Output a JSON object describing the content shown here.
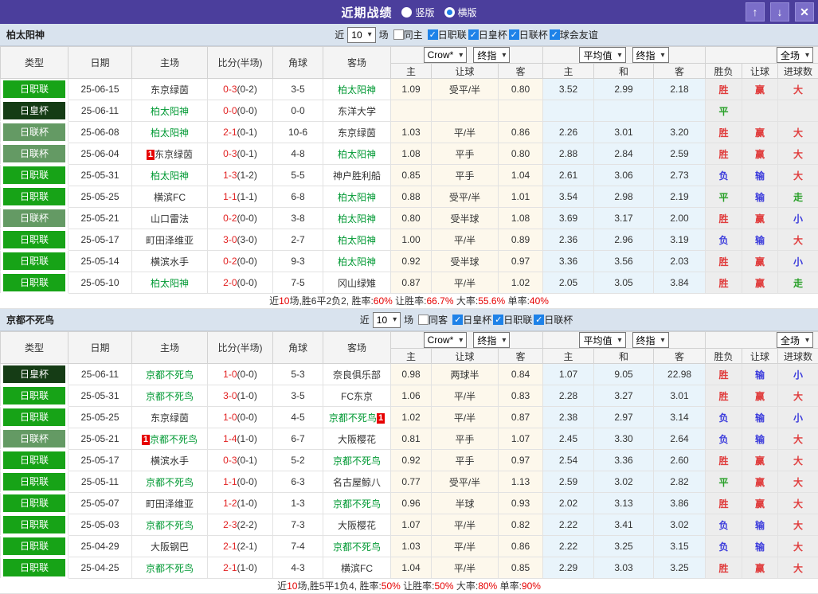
{
  "titlebar": {
    "title": "近期战绩",
    "radio_vertical": "竖版",
    "radio_horizontal": "横版",
    "selected_mode": "横版"
  },
  "icons": {
    "up": "↑",
    "down": "↓",
    "close": "✕",
    "check": "✓",
    "select_arrow": "▾"
  },
  "colors": {
    "titlebar_bg": "#4b3e9c",
    "button_bg": "#7b6ec9",
    "filter_bg": "#d9e3ee",
    "checkbox_blue": "#1e82e8",
    "score_red": "#e22020",
    "focus_green": "#009933",
    "summary_red": "#e60000",
    "asia_col_bg": "#fdf8ec",
    "avg_col_bg": "#e9f4fb",
    "result_col_bg": "#ededed",
    "league": {
      "日职联": "#17a317",
      "日皇杯": "#153c15",
      "日联杯": "#649a64"
    },
    "result": {
      "胜": "#e03c3c",
      "负": "#3c3cdc",
      "平": "#28a028",
      "赢": "#e03c3c",
      "输": "#3c3cdc",
      "走": "#28a028",
      "大": "#e03c3c",
      "小": "#3c3cdc"
    }
  },
  "table_head": {
    "type": "类型",
    "date": "日期",
    "home": "主场",
    "score": "比分(半场)",
    "corners": "角球",
    "away": "客场",
    "asia_sub": [
      "主",
      "让球",
      "客"
    ],
    "euro_sub": [
      "主",
      "和",
      "客"
    ],
    "result_sub": [
      "胜负",
      "让球",
      "进球数"
    ],
    "selects": {
      "bookmaker": "Crow*",
      "final1": "终指",
      "average": "平均值",
      "final2": "终指",
      "scope": "全场"
    }
  },
  "sections": [
    {
      "team": "柏太阳神",
      "filter": {
        "prefix": "近",
        "count": "10",
        "suffix": "场",
        "same": "同主",
        "same_checked": false,
        "leagues": [
          "日职联",
          "日皇杯",
          "日联杯",
          "球会友谊"
        ]
      },
      "rows": [
        {
          "league": "日职联",
          "date": "25-06-15",
          "home": "东京绿茵",
          "home_focus": false,
          "home_card": "",
          "score": "0-3",
          "half": "(0-2)",
          "corners": "3-5",
          "away": "柏太阳神",
          "away_focus": true,
          "away_card": "",
          "odds": [
            "1.09",
            "受平/半",
            "0.80"
          ],
          "avg": [
            "3.52",
            "2.99",
            "2.18"
          ],
          "result": [
            "胜",
            "赢",
            "大"
          ]
        },
        {
          "league": "日皇杯",
          "date": "25-06-11",
          "home": "柏太阳神",
          "home_focus": true,
          "home_card": "",
          "score": "0-0",
          "half": "(0-0)",
          "corners": "0-0",
          "away": "东洋大学",
          "away_focus": false,
          "away_card": "",
          "odds": [
            "",
            "",
            ""
          ],
          "avg": [
            "",
            "",
            ""
          ],
          "result": [
            "平",
            "",
            ""
          ]
        },
        {
          "league": "日联杯",
          "date": "25-06-08",
          "home": "柏太阳神",
          "home_focus": true,
          "home_card": "",
          "score": "2-1",
          "half": "(0-1)",
          "corners": "10-6",
          "away": "东京绿茵",
          "away_focus": false,
          "away_card": "",
          "odds": [
            "1.03",
            "平/半",
            "0.86"
          ],
          "avg": [
            "2.26",
            "3.01",
            "3.20"
          ],
          "result": [
            "胜",
            "赢",
            "大"
          ]
        },
        {
          "league": "日联杯",
          "date": "25-06-04",
          "home": "东京绿茵",
          "home_focus": false,
          "home_card": "1",
          "score": "0-3",
          "half": "(0-1)",
          "corners": "4-8",
          "away": "柏太阳神",
          "away_focus": true,
          "away_card": "",
          "odds": [
            "1.08",
            "平手",
            "0.80"
          ],
          "avg": [
            "2.88",
            "2.84",
            "2.59"
          ],
          "result": [
            "胜",
            "赢",
            "大"
          ]
        },
        {
          "league": "日职联",
          "date": "25-05-31",
          "home": "柏太阳神",
          "home_focus": true,
          "home_card": "",
          "score": "1-3",
          "half": "(1-2)",
          "corners": "5-5",
          "away": "神户胜利船",
          "away_focus": false,
          "away_card": "",
          "odds": [
            "0.85",
            "平手",
            "1.04"
          ],
          "avg": [
            "2.61",
            "3.06",
            "2.73"
          ],
          "result": [
            "负",
            "输",
            "大"
          ]
        },
        {
          "league": "日职联",
          "date": "25-05-25",
          "home": "横滨FC",
          "home_focus": false,
          "home_card": "",
          "score": "1-1",
          "half": "(1-1)",
          "corners": "6-8",
          "away": "柏太阳神",
          "away_focus": true,
          "away_card": "",
          "odds": [
            "0.88",
            "受平/半",
            "1.01"
          ],
          "avg": [
            "3.54",
            "2.98",
            "2.19"
          ],
          "result": [
            "平",
            "输",
            "走"
          ]
        },
        {
          "league": "日联杯",
          "date": "25-05-21",
          "home": "山口雷法",
          "home_focus": false,
          "home_card": "",
          "score": "0-2",
          "half": "(0-0)",
          "corners": "3-8",
          "away": "柏太阳神",
          "away_focus": true,
          "away_card": "",
          "odds": [
            "0.80",
            "受半球",
            "1.08"
          ],
          "avg": [
            "3.69",
            "3.17",
            "2.00"
          ],
          "result": [
            "胜",
            "赢",
            "小"
          ]
        },
        {
          "league": "日职联",
          "date": "25-05-17",
          "home": "町田泽维亚",
          "home_focus": false,
          "home_card": "",
          "score": "3-0",
          "half": "(3-0)",
          "corners": "2-7",
          "away": "柏太阳神",
          "away_focus": true,
          "away_card": "",
          "odds": [
            "1.00",
            "平/半",
            "0.89"
          ],
          "avg": [
            "2.36",
            "2.96",
            "3.19"
          ],
          "result": [
            "负",
            "输",
            "大"
          ]
        },
        {
          "league": "日职联",
          "date": "25-05-14",
          "home": "横滨水手",
          "home_focus": false,
          "home_card": "",
          "score": "0-2",
          "half": "(0-0)",
          "corners": "9-3",
          "away": "柏太阳神",
          "away_focus": true,
          "away_card": "",
          "odds": [
            "0.92",
            "受半球",
            "0.97"
          ],
          "avg": [
            "3.36",
            "3.56",
            "2.03"
          ],
          "result": [
            "胜",
            "赢",
            "小"
          ]
        },
        {
          "league": "日职联",
          "date": "25-05-10",
          "home": "柏太阳神",
          "home_focus": true,
          "home_card": "",
          "score": "2-0",
          "half": "(0-0)",
          "corners": "7-5",
          "away": "冈山绿雉",
          "away_focus": false,
          "away_card": "",
          "odds": [
            "0.87",
            "平/半",
            "1.02"
          ],
          "avg": [
            "2.05",
            "3.05",
            "3.84"
          ],
          "result": [
            "胜",
            "赢",
            "走"
          ]
        }
      ],
      "summary": [
        {
          "text": "近",
          "red": false
        },
        {
          "text": "10",
          "red": true
        },
        {
          "text": "场,胜6平2负2, 胜率:",
          "red": false
        },
        {
          "text": "60%",
          "red": true
        },
        {
          "text": " 让胜率:",
          "red": false
        },
        {
          "text": "66.7%",
          "red": true
        },
        {
          "text": " 大率:",
          "red": false
        },
        {
          "text": "55.6%",
          "red": true
        },
        {
          "text": " 单率:",
          "red": false
        },
        {
          "text": "40%",
          "red": true
        }
      ]
    },
    {
      "team": "京都不死鸟",
      "filter": {
        "prefix": "近",
        "count": "10",
        "suffix": "场",
        "same": "同客",
        "same_checked": false,
        "leagues": [
          "日皇杯",
          "日职联",
          "日联杯"
        ]
      },
      "rows": [
        {
          "league": "日皇杯",
          "date": "25-06-11",
          "home": "京都不死鸟",
          "home_focus": true,
          "home_card": "",
          "score": "1-0",
          "half": "(0-0)",
          "corners": "5-3",
          "away": "奈良俱乐部",
          "away_focus": false,
          "away_card": "",
          "odds": [
            "0.98",
            "两球半",
            "0.84"
          ],
          "avg": [
            "1.07",
            "9.05",
            "22.98"
          ],
          "result": [
            "胜",
            "输",
            "小"
          ]
        },
        {
          "league": "日职联",
          "date": "25-05-31",
          "home": "京都不死鸟",
          "home_focus": true,
          "home_card": "",
          "score": "3-0",
          "half": "(1-0)",
          "corners": "3-5",
          "away": "FC东京",
          "away_focus": false,
          "away_card": "",
          "odds": [
            "1.06",
            "平/半",
            "0.83"
          ],
          "avg": [
            "2.28",
            "3.27",
            "3.01"
          ],
          "result": [
            "胜",
            "赢",
            "大"
          ]
        },
        {
          "league": "日职联",
          "date": "25-05-25",
          "home": "东京绿茵",
          "home_focus": false,
          "home_card": "",
          "score": "1-0",
          "half": "(0-0)",
          "corners": "4-5",
          "away": "京都不死鸟",
          "away_focus": true,
          "away_card": "1",
          "odds": [
            "1.02",
            "平/半",
            "0.87"
          ],
          "avg": [
            "2.38",
            "2.97",
            "3.14"
          ],
          "result": [
            "负",
            "输",
            "小"
          ]
        },
        {
          "league": "日联杯",
          "date": "25-05-21",
          "home": "京都不死鸟",
          "home_focus": true,
          "home_card": "1",
          "score": "1-4",
          "half": "(1-0)",
          "corners": "6-7",
          "away": "大阪樱花",
          "away_focus": false,
          "away_card": "",
          "odds": [
            "0.81",
            "平手",
            "1.07"
          ],
          "avg": [
            "2.45",
            "3.30",
            "2.64"
          ],
          "result": [
            "负",
            "输",
            "大"
          ]
        },
        {
          "league": "日职联",
          "date": "25-05-17",
          "home": "横滨水手",
          "home_focus": false,
          "home_card": "",
          "score": "0-3",
          "half": "(0-1)",
          "corners": "5-2",
          "away": "京都不死鸟",
          "away_focus": true,
          "away_card": "",
          "odds": [
            "0.92",
            "平手",
            "0.97"
          ],
          "avg": [
            "2.54",
            "3.36",
            "2.60"
          ],
          "result": [
            "胜",
            "赢",
            "大"
          ]
        },
        {
          "league": "日职联",
          "date": "25-05-11",
          "home": "京都不死鸟",
          "home_focus": true,
          "home_card": "",
          "score": "1-1",
          "half": "(0-0)",
          "corners": "6-3",
          "away": "名古屋鲸八",
          "away_focus": false,
          "away_card": "",
          "odds": [
            "0.77",
            "受平/半",
            "1.13"
          ],
          "avg": [
            "2.59",
            "3.02",
            "2.82"
          ],
          "result": [
            "平",
            "赢",
            "大"
          ]
        },
        {
          "league": "日职联",
          "date": "25-05-07",
          "home": "町田泽维亚",
          "home_focus": false,
          "home_card": "",
          "score": "1-2",
          "half": "(1-0)",
          "corners": "1-3",
          "away": "京都不死鸟",
          "away_focus": true,
          "away_card": "",
          "odds": [
            "0.96",
            "半球",
            "0.93"
          ],
          "avg": [
            "2.02",
            "3.13",
            "3.86"
          ],
          "result": [
            "胜",
            "赢",
            "大"
          ]
        },
        {
          "league": "日职联",
          "date": "25-05-03",
          "home": "京都不死鸟",
          "home_focus": true,
          "home_card": "",
          "score": "2-3",
          "half": "(2-2)",
          "corners": "7-3",
          "away": "大阪樱花",
          "away_focus": false,
          "away_card": "",
          "odds": [
            "1.07",
            "平/半",
            "0.82"
          ],
          "avg": [
            "2.22",
            "3.41",
            "3.02"
          ],
          "result": [
            "负",
            "输",
            "大"
          ]
        },
        {
          "league": "日职联",
          "date": "25-04-29",
          "home": "大阪钢巴",
          "home_focus": false,
          "home_card": "",
          "score": "2-1",
          "half": "(2-1)",
          "corners": "7-4",
          "away": "京都不死鸟",
          "away_focus": true,
          "away_card": "",
          "odds": [
            "1.03",
            "平/半",
            "0.86"
          ],
          "avg": [
            "2.22",
            "3.25",
            "3.15"
          ],
          "result": [
            "负",
            "输",
            "大"
          ]
        },
        {
          "league": "日职联",
          "date": "25-04-25",
          "home": "京都不死鸟",
          "home_focus": true,
          "home_card": "",
          "score": "2-1",
          "half": "(1-0)",
          "corners": "4-3",
          "away": "横滨FC",
          "away_focus": false,
          "away_card": "",
          "odds": [
            "1.04",
            "平/半",
            "0.85"
          ],
          "avg": [
            "2.29",
            "3.03",
            "3.25"
          ],
          "result": [
            "胜",
            "赢",
            "大"
          ]
        }
      ],
      "summary": [
        {
          "text": "近",
          "red": false
        },
        {
          "text": "10",
          "red": true
        },
        {
          "text": "场,胜5平1负4, 胜率:",
          "red": false
        },
        {
          "text": "50%",
          "red": true
        },
        {
          "text": " 让胜率:",
          "red": false
        },
        {
          "text": "50%",
          "red": true
        },
        {
          "text": " 大率:",
          "red": false
        },
        {
          "text": "80%",
          "red": true
        },
        {
          "text": " 单率:",
          "red": false
        },
        {
          "text": "90%",
          "red": true
        }
      ]
    }
  ]
}
